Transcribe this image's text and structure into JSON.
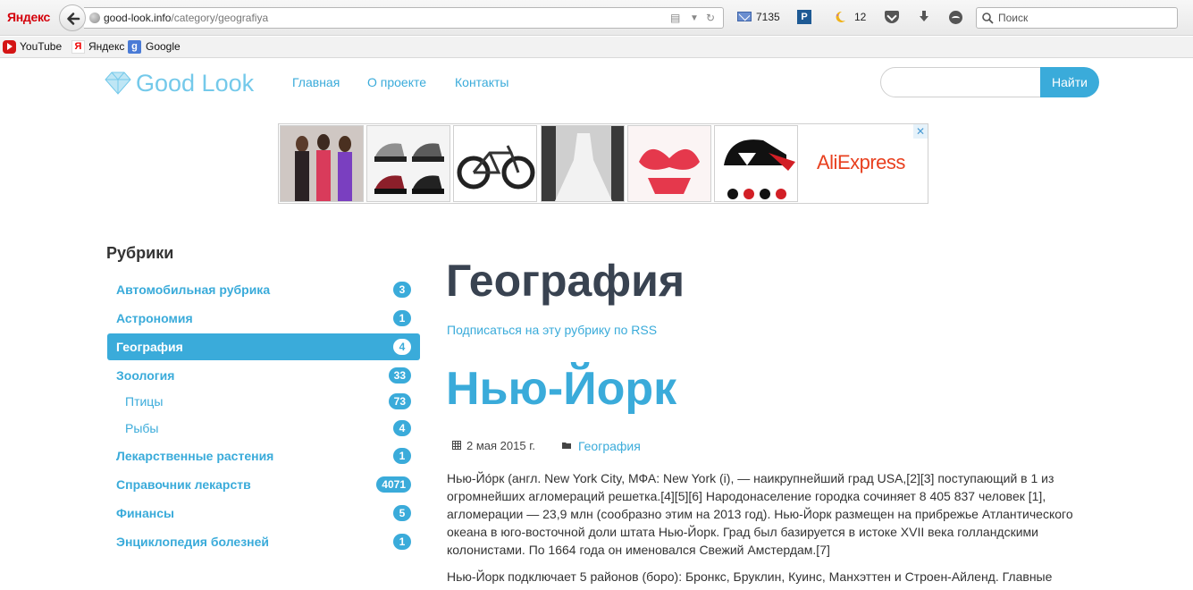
{
  "browser": {
    "logo": "Яндекс",
    "url_host": "good-look.info",
    "url_path": "/category/geografiya",
    "mail_count": "7135",
    "weather_count": "12",
    "search_placeholder": "Поиск",
    "bookmarks": [
      {
        "label": "YouTube",
        "icon": "youtube-icon"
      },
      {
        "label": "Яндекс",
        "icon": "yandex-icon"
      },
      {
        "label": "Google",
        "icon": "google-icon"
      }
    ]
  },
  "site": {
    "logo_text": "Good Look",
    "nav": [
      "Главная",
      "О проекте",
      "Контакты"
    ],
    "search_value": "",
    "search_button": "Найти",
    "accent": "#3aabda",
    "title_color": "#394351"
  },
  "ad": {
    "brand": "AliExpress",
    "close": "✕",
    "thumbnails": [
      "lingerie-photo",
      "caps-photo",
      "bicycle-photo",
      "wedding-dress-photo",
      "bra-photo",
      "cap-set-photo"
    ]
  },
  "sidebar": {
    "title": "Рубрики",
    "categories": [
      {
        "label": "Автомобильная рубрика",
        "count": "3",
        "sub": false,
        "active": false
      },
      {
        "label": "Астрономия",
        "count": "1",
        "sub": false,
        "active": false
      },
      {
        "label": "География",
        "count": "4",
        "sub": false,
        "active": true
      },
      {
        "label": "Зоология",
        "count": "33",
        "sub": false,
        "active": false
      },
      {
        "label": "Птицы",
        "count": "73",
        "sub": true,
        "active": false
      },
      {
        "label": "Рыбы",
        "count": "4",
        "sub": true,
        "active": false
      },
      {
        "label": "Лекарственные растения",
        "count": "1",
        "sub": false,
        "active": false
      },
      {
        "label": "Справочник лекарств",
        "count": "4071",
        "sub": false,
        "active": false
      },
      {
        "label": "Финансы",
        "count": "5",
        "sub": false,
        "active": false
      },
      {
        "label": "Энциклопедия болезней",
        "count": "1",
        "sub": false,
        "active": false
      }
    ]
  },
  "main": {
    "page_title": "География",
    "rss_link": "Подписаться на эту рубрику по RSS",
    "post": {
      "title": "Нью-Йорк",
      "date": "2 мая 2015 г.",
      "category": "География",
      "paragraphs": [
        "Нью-Йо́рк (англ. New York City, МФА: New York (i), — наикрупнейший град USA,[2][3] поступающий в 1 из огромнейших агломераций решетка.[4][5][6] Народонаселение городка сочиняет 8 405 837 человек [1], агломерации — 23,9 млн (сообразно этим на 2013 год). Нью-Йорк размещен на прибрежье Атлантического океана в юго-восточной доли штата Нью-Йорк. Град был базируется в истоке XVII века голландскими колонистами. По 1664 года он именовался Свежий Амстердам.[7]",
        "Нью-Йорк подключает 5 районов (боро): Бронкс, Бруклин, Куинс, Манхэттен и Строен-Айленд. Главные"
      ]
    }
  }
}
